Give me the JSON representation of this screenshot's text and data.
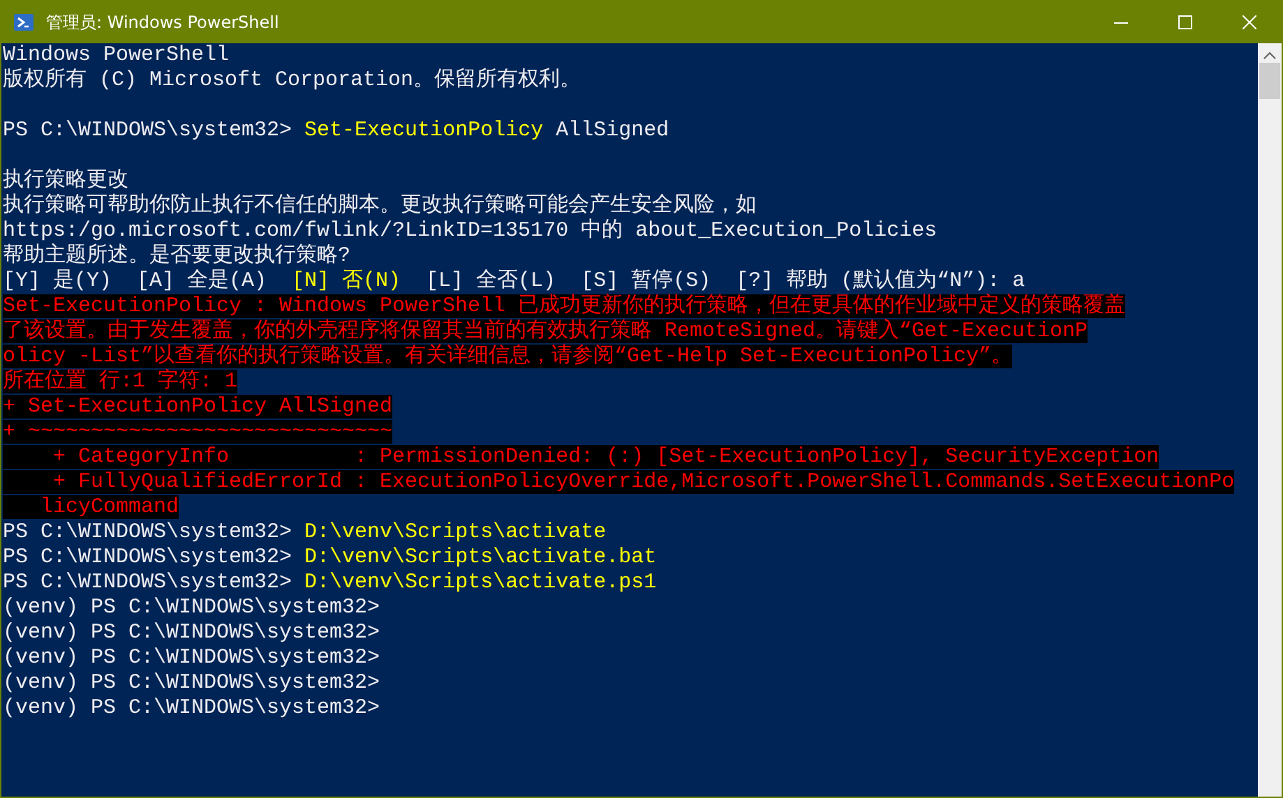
{
  "window": {
    "title": "管理员: Windows PowerShell"
  },
  "lines": [
    {
      "kind": "text",
      "segments": [
        {
          "kind": "plain",
          "text": "Windows PowerShell"
        }
      ]
    },
    {
      "kind": "text",
      "segments": [
        {
          "kind": "plain",
          "text": "版权所有 (C) Microsoft Corporation。保留所有权利。"
        }
      ]
    },
    {
      "kind": "blank"
    },
    {
      "kind": "text",
      "segments": [
        {
          "kind": "plain",
          "text": "PS C:\\WINDOWS\\system32> "
        },
        {
          "kind": "command",
          "text": "Set-ExecutionPolicy"
        },
        {
          "kind": "plain",
          "text": " AllSigned"
        }
      ]
    },
    {
      "kind": "blank"
    },
    {
      "kind": "text",
      "segments": [
        {
          "kind": "plain",
          "text": "执行策略更改"
        }
      ]
    },
    {
      "kind": "text",
      "segments": [
        {
          "kind": "plain",
          "text": "执行策略可帮助你防止执行不信任的脚本。更改执行策略可能会产生安全风险，如"
        }
      ]
    },
    {
      "kind": "text",
      "segments": [
        {
          "kind": "plain",
          "text": "https:/go.microsoft.com/fwlink/?LinkID=135170 中的 about_Execution_Policies"
        }
      ]
    },
    {
      "kind": "text",
      "segments": [
        {
          "kind": "plain",
          "text": "帮助主题所述。是否要更改执行策略?"
        }
      ]
    },
    {
      "kind": "text",
      "segments": [
        {
          "kind": "plain",
          "text": "[Y] 是(Y)  [A] 全是(A)  "
        },
        {
          "kind": "command",
          "text": "[N] 否(N)"
        },
        {
          "kind": "plain",
          "text": "  [L] 全否(L)  [S] 暂停(S)  [?] 帮助 (默认值为“N”): a"
        }
      ]
    },
    {
      "kind": "text",
      "segments": [
        {
          "kind": "error",
          "text": "Set-ExecutionPolicy : Windows PowerShell 已成功更新你的执行策略，但在更具体的作业域中定义的策略覆盖"
        }
      ]
    },
    {
      "kind": "text",
      "segments": [
        {
          "kind": "error",
          "text": "了该设置。由于发生覆盖，你的外壳程序将保留其当前的有效执行策略 RemoteSigned。请键入“Get-ExecutionP"
        }
      ]
    },
    {
      "kind": "text",
      "segments": [
        {
          "kind": "error",
          "text": "olicy -List”以查看你的执行策略设置。有关详细信息，请参阅“Get-Help Set-ExecutionPolicy”。"
        }
      ]
    },
    {
      "kind": "text",
      "segments": [
        {
          "kind": "error",
          "text": "所在位置 行:1 字符: 1"
        }
      ]
    },
    {
      "kind": "text",
      "segments": [
        {
          "kind": "error",
          "text": "+ Set-ExecutionPolicy AllSigned"
        }
      ]
    },
    {
      "kind": "text",
      "segments": [
        {
          "kind": "error",
          "text": "+ ~~~~~~~~~~~~~~~~~~~~~~~~~~~~~"
        }
      ]
    },
    {
      "kind": "text",
      "segments": [
        {
          "kind": "error",
          "text": "    + CategoryInfo          : PermissionDenied: (:) [Set-ExecutionPolicy], SecurityException"
        }
      ]
    },
    {
      "kind": "text",
      "segments": [
        {
          "kind": "error",
          "text": "    + FullyQualifiedErrorId : ExecutionPolicyOverride,Microsoft.PowerShell.Commands.SetExecutionPo"
        }
      ]
    },
    {
      "kind": "text",
      "segments": [
        {
          "kind": "error",
          "text": "   licyCommand"
        }
      ]
    },
    {
      "kind": "text",
      "segments": [
        {
          "kind": "plain",
          "text": "PS C:\\WINDOWS\\system32> "
        },
        {
          "kind": "command",
          "text": "D:\\venv\\Scripts\\activate"
        }
      ]
    },
    {
      "kind": "text",
      "segments": [
        {
          "kind": "plain",
          "text": "PS C:\\WINDOWS\\system32> "
        },
        {
          "kind": "command",
          "text": "D:\\venv\\Scripts\\activate.bat"
        }
      ]
    },
    {
      "kind": "text",
      "segments": [
        {
          "kind": "plain",
          "text": "PS C:\\WINDOWS\\system32> "
        },
        {
          "kind": "command",
          "text": "D:\\venv\\Scripts\\activate.ps1"
        }
      ]
    },
    {
      "kind": "text",
      "segments": [
        {
          "kind": "plain",
          "text": "(venv) PS C:\\WINDOWS\\system32>"
        }
      ]
    },
    {
      "kind": "text",
      "segments": [
        {
          "kind": "plain",
          "text": "(venv) PS C:\\WINDOWS\\system32>"
        }
      ]
    },
    {
      "kind": "text",
      "segments": [
        {
          "kind": "plain",
          "text": "(venv) PS C:\\WINDOWS\\system32>"
        }
      ]
    },
    {
      "kind": "text",
      "segments": [
        {
          "kind": "plain",
          "text": "(venv) PS C:\\WINDOWS\\system32>"
        }
      ]
    },
    {
      "kind": "text",
      "segments": [
        {
          "kind": "plain",
          "text": "(venv) PS C:\\WINDOWS\\system32>"
        }
      ]
    }
  ]
}
